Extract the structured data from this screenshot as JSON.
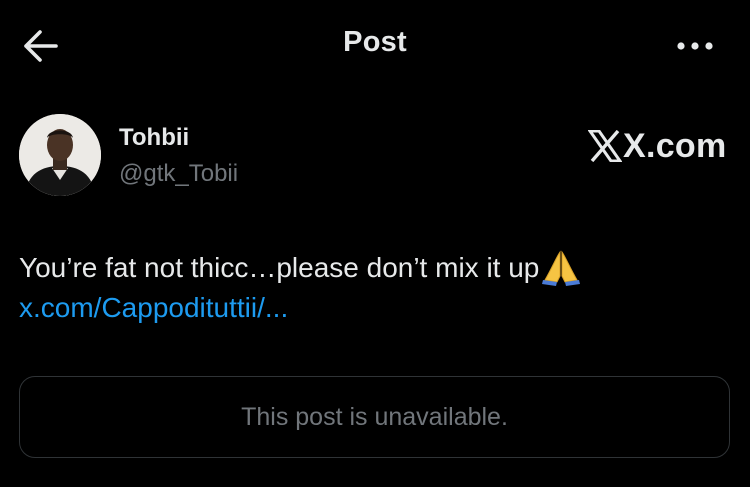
{
  "header": {
    "title": "Post",
    "back_icon": "arrow-left-icon",
    "more_icon": "more-horizontal-icon"
  },
  "post": {
    "author_name": "Tohbii",
    "author_handle": "@gtk_Tobii",
    "brand": "X.com",
    "text": "You’re fat not thicc…please don’t mix it up",
    "emoji": "🙏",
    "link_text": "x.com/Cappodituttii/...",
    "quoted_unavailable": "This post is unavailable."
  },
  "colors": {
    "background": "#000000",
    "primary_text": "#e7e9ea",
    "secondary_text": "#71767b",
    "link": "#1d9bf0",
    "card_border": "#2f3336"
  }
}
